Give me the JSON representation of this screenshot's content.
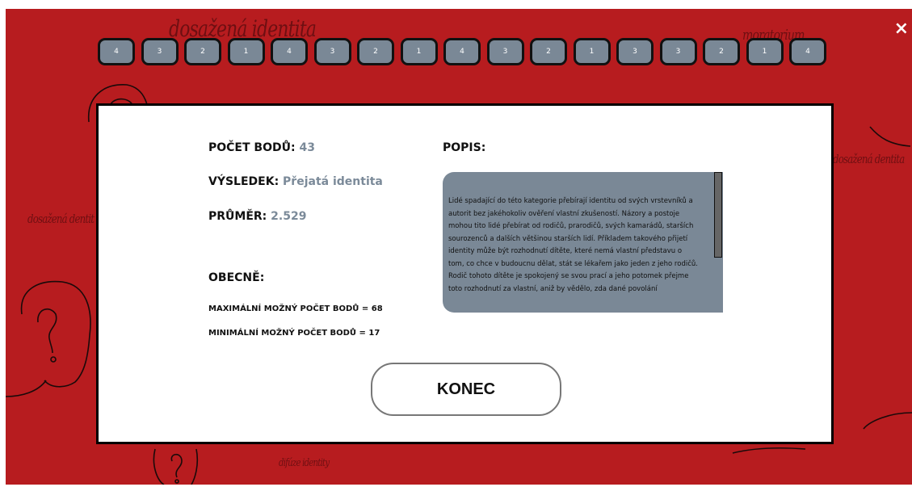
{
  "background": {
    "labels": [
      "dosažená identita",
      "moratorium",
      "dosažená dentita",
      "dosažená dentit",
      "difúze identity"
    ]
  },
  "header": {
    "close_icon": "×",
    "answers": [
      "4",
      "3",
      "2",
      "1",
      "4",
      "3",
      "2",
      "1",
      "4",
      "3",
      "2",
      "1",
      "3",
      "3",
      "2",
      "1",
      "4"
    ]
  },
  "result": {
    "points_label": "POČET BODŮ:",
    "points_value": "43",
    "result_label": "VÝSLEDEK:",
    "result_value": "Přejatá identita",
    "average_label": "PRŮMĚR:",
    "average_value": "2.529",
    "general_heading": "OBECNĚ:",
    "max_points": "MAXIMÁLNÍ MOŽNÝ POČET BODŮ = 68",
    "min_points": "MINIMÁLNÍ MOŽNÝ POČET BODŮ = 17"
  },
  "description": {
    "heading": "POPIS:",
    "text": "Lidé spadající do této kategorie přebírají identitu od svých vrstevníků a autorit bez jakéhokoliv ověření vlastní zkušeností. Názory a postoje mohou tito lidé přebírat od rodičů, prarodičů, svých kamarádů, starších sourozenců a dalších většinou starších lidí. Příkladem takového přijetí identity může být rozhodnutí dítěte, které nemá vlastní představu o tom, co chce v budoucnu dělat, stát se lékařem jako jeden z jeho rodičů. Rodič tohoto dítěte je spokojený se svou prací a jeho potomek přejme toto rozhodnutí za vlastní, aniž by vědělo, zda dané povolání"
  },
  "actions": {
    "end_label": "KONEC"
  }
}
